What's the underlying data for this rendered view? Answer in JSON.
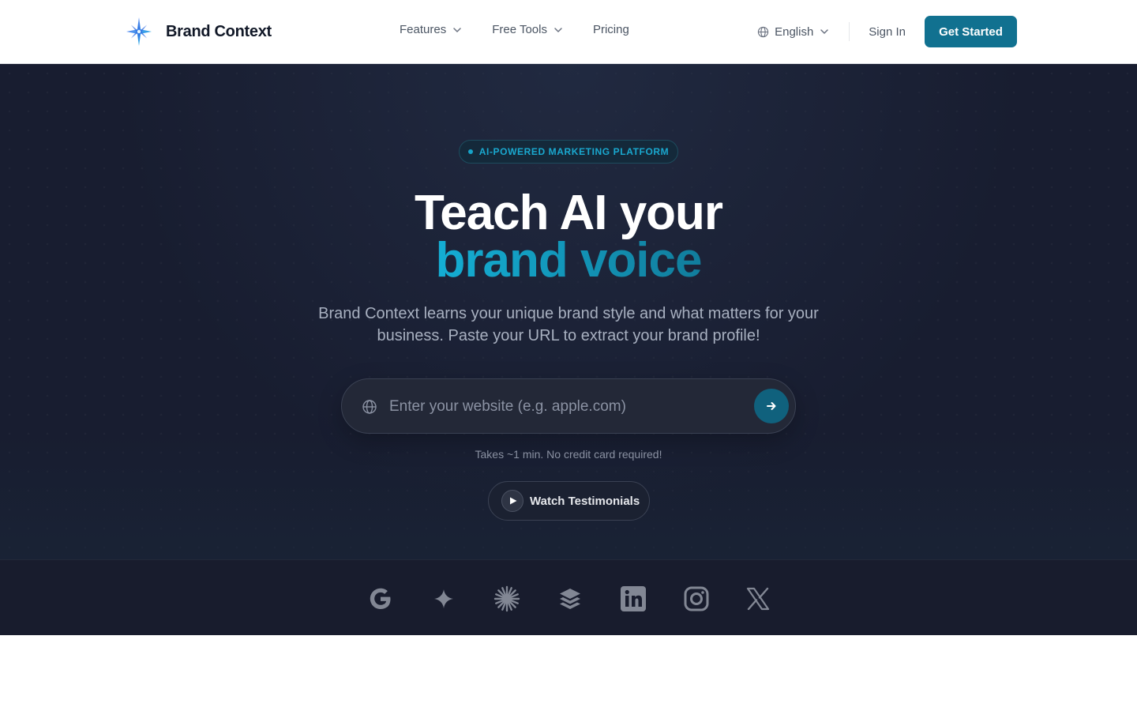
{
  "header": {
    "brand_name": "Brand Context",
    "logo_icon": "compass-star-icon",
    "nav": [
      {
        "label": "Features",
        "has_dropdown": true
      },
      {
        "label": "Free Tools",
        "has_dropdown": true
      },
      {
        "label": "Pricing",
        "has_dropdown": false
      }
    ],
    "language": {
      "label": "English",
      "icon": "globe-icon"
    },
    "sign_in": "Sign In",
    "cta": "Get Started"
  },
  "hero": {
    "badge": "AI-POWERED MARKETING PLATFORM",
    "title_line1": "Teach AI your",
    "title_line2": "brand voice",
    "subtitle": "Brand Context learns your unique brand style and what matters for your business. Paste your URL to extract your brand profile!",
    "search": {
      "placeholder": "Enter your website (e.g. apple.com)",
      "value": "",
      "leading_icon": "globe-icon",
      "submit_icon": "arrow-right-icon"
    },
    "note": "Takes ~1 min. No credit card required!",
    "watch_button": {
      "label": "Watch Testimonials",
      "icon": "play-icon"
    }
  },
  "integrations": [
    {
      "name": "google-icon"
    },
    {
      "name": "gemini-sparkle-icon"
    },
    {
      "name": "claude-burst-icon"
    },
    {
      "name": "buffer-stack-icon"
    },
    {
      "name": "linkedin-icon"
    },
    {
      "name": "instagram-icon"
    },
    {
      "name": "x-icon"
    }
  ],
  "colors": {
    "primary": "#117190",
    "accent": "#119bbd",
    "hero_bg": "#181d30",
    "strip_bg": "#181c2d",
    "text_dark": "#111827",
    "text_muted": "#4b5563"
  }
}
